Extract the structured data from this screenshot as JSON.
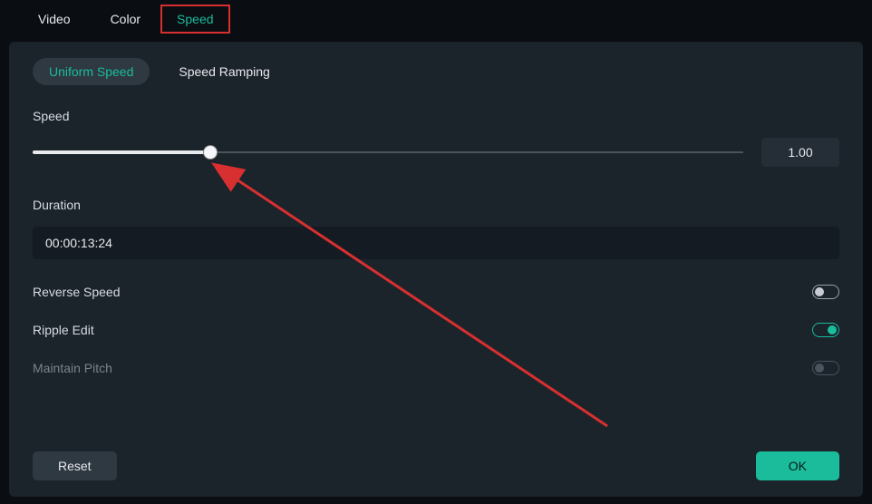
{
  "topTabs": {
    "video": "Video",
    "color": "Color",
    "speed": "Speed"
  },
  "subTabs": {
    "uniform": "Uniform Speed",
    "ramping": "Speed Ramping"
  },
  "speed": {
    "label": "Speed",
    "value": "1.00"
  },
  "duration": {
    "label": "Duration",
    "value": "00:00:13:24"
  },
  "toggles": {
    "reverseSpeed": {
      "label": "Reverse Speed",
      "on": false
    },
    "rippleEdit": {
      "label": "Ripple Edit",
      "on": true
    },
    "maintainPitch": {
      "label": "Maintain Pitch",
      "on": false
    }
  },
  "buttons": {
    "reset": "Reset",
    "ok": "OK"
  },
  "colors": {
    "accent": "#1abc9c",
    "highlight": "#d83030"
  }
}
